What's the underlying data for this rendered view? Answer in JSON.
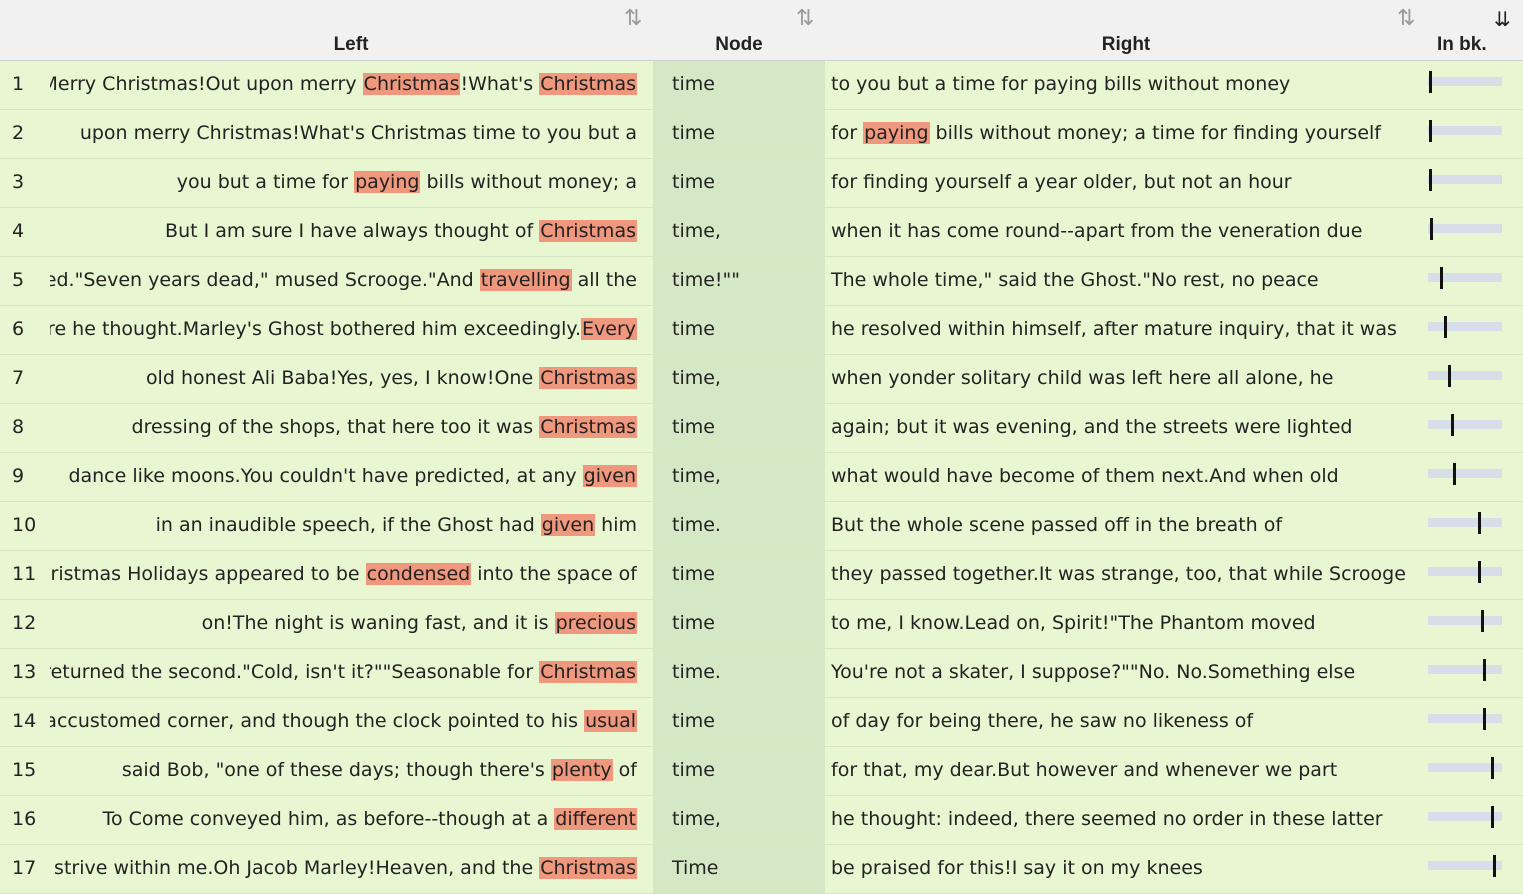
{
  "columns": {
    "left": "Left",
    "node": "Node",
    "right": "Right",
    "inbook": "In bk."
  },
  "rows": [
    {
      "num": "1",
      "lpre": "?Merry Christmas!Out upon merry ",
      "lkw": "Christmas",
      "lpost": "!What's ",
      "lkw2": "Christmas",
      "lpost2": "",
      "node": "time",
      "rpre": "to you but a time for paying bills without money",
      "rkw": "",
      "rpost": "",
      "pos": 0.02
    },
    {
      "num": "2",
      "lpre": "upon merry Christmas!What's Christmas time to you but a",
      "lkw": "",
      "lpost": "",
      "lkw2": "",
      "lpost2": "",
      "node": "time",
      "rpre": "for ",
      "rkw": "paying",
      "rpost": " bills without money; a time for finding yourself",
      "pos": 0.02
    },
    {
      "num": "3",
      "lpre": "you but a time for ",
      "lkw": "paying",
      "lpost": " bills without money; a",
      "lkw2": "",
      "lpost2": "",
      "node": "time",
      "rpre": "for finding yourself a year older, but not an hour",
      "rkw": "",
      "rpost": "",
      "pos": 0.02
    },
    {
      "num": "4",
      "lpre": "But I am sure I have always thought of ",
      "lkw": "Christmas",
      "lpost": "",
      "lkw2": "",
      "lpost2": "",
      "node": "time,",
      "rpre": "when it has come round--apart from the veneration due",
      "rkw": "",
      "rpost": "",
      "pos": 0.03
    },
    {
      "num": "5",
      "lpre": "ated.\"Seven years dead,\" mused Scrooge.\"And ",
      "lkw": "travelling",
      "lpost": " all the",
      "lkw2": "",
      "lpost2": "",
      "node": "time!\"\"",
      "rpre": "The whole time,\" said the Ghost.\"No rest, no peace",
      "rkw": "",
      "rpost": "",
      "pos": 0.17
    },
    {
      "num": "6",
      "lpre": "ore he thought.Marley's Ghost bothered him exceedingly.",
      "lkw": "Every",
      "lpost": "",
      "lkw2": "",
      "lpost2": "",
      "node": "time",
      "rpre": "he resolved within himself, after mature inquiry, that it was",
      "rkw": "",
      "rpost": "",
      "pos": 0.22
    },
    {
      "num": "7",
      "lpre": "old honest Ali Baba!Yes, yes, I know!One ",
      "lkw": "Christmas",
      "lpost": "",
      "lkw2": "",
      "lpost2": "",
      "node": "time,",
      "rpre": "when yonder solitary child was left here all alone, he",
      "rkw": "",
      "rpost": "",
      "pos": 0.28
    },
    {
      "num": "8",
      "lpre": "dressing of the shops, that here too it was ",
      "lkw": "Christmas",
      "lpost": "",
      "lkw2": "",
      "lpost2": "",
      "node": "time",
      "rpre": "again; but it was evening, and the streets were lighted",
      "rkw": "",
      "rpost": "",
      "pos": 0.32
    },
    {
      "num": "9",
      "lpre": "dance like moons.You couldn't have predicted, at any ",
      "lkw": "given",
      "lpost": "",
      "lkw2": "",
      "lpost2": "",
      "node": "time,",
      "rpre": "what would have become of them next.And when old",
      "rkw": "",
      "rpost": "",
      "pos": 0.35
    },
    {
      "num": "10",
      "lpre": "in an inaudible speech, if the Ghost had ",
      "lkw": "given",
      "lpost": " him",
      "lkw2": "",
      "lpost2": "",
      "node": "time.",
      "rpre": "But the whole scene passed off in the breath of",
      "rkw": "",
      "rpost": "",
      "pos": 0.7
    },
    {
      "num": "11",
      "lpre": "hristmas Holidays appeared to be ",
      "lkw": "condensed",
      "lpost": " into the space of",
      "lkw2": "",
      "lpost2": "",
      "node": "time",
      "rpre": "they passed together.It was strange, too, that while Scrooge",
      "rkw": "",
      "rpost": "",
      "pos": 0.71
    },
    {
      "num": "12",
      "lpre": "on!The night is waning fast, and it is ",
      "lkw": "precious",
      "lpost": "",
      "lkw2": "",
      "lpost2": "",
      "node": "time",
      "rpre": "to me, I know.Lead on, Spirit!\"The Phantom moved",
      "rkw": "",
      "rpost": "",
      "pos": 0.75
    },
    {
      "num": "13",
      "lpre": "returned the second.\"Cold, isn't it?\"\"Seasonable for ",
      "lkw": "Christmas",
      "lpost": "",
      "lkw2": "",
      "lpost2": "",
      "node": "time.",
      "rpre": "You're not a skater, I suppose?\"\"No. No.Something else",
      "rkw": "",
      "rpost": "",
      "pos": 0.77
    },
    {
      "num": "14",
      "lpre": "accustomed corner, and though the clock pointed to his ",
      "lkw": "usual",
      "lpost": "",
      "lkw2": "",
      "lpost2": "",
      "node": "time",
      "rpre": "of day for being there, he saw no likeness of",
      "rkw": "",
      "rpost": "",
      "pos": 0.78
    },
    {
      "num": "15",
      "lpre": "said Bob, \"one of these days; though there's ",
      "lkw": "plenty",
      "lpost": " of",
      "lkw2": "",
      "lpost2": "",
      "node": "time",
      "rpre": "for that, my dear.But however and whenever we part",
      "rkw": "",
      "rpost": "",
      "pos": 0.89
    },
    {
      "num": "16",
      "lpre": "To Come conveyed him, as before--though at a ",
      "lkw": "different",
      "lpost": "",
      "lkw2": "",
      "lpost2": "",
      "node": "time,",
      "rpre": "he thought: indeed, there seemed no order in these latter",
      "rkw": "",
      "rpost": "",
      "pos": 0.89
    },
    {
      "num": "17",
      "lpre": "strive within me.Oh Jacob Marley!Heaven, and the ",
      "lkw": "Christmas",
      "lpost": "",
      "lkw2": "",
      "lpost2": "",
      "node": "Time",
      "rpre": "be praised for this!I say it on my knees",
      "rkw": "",
      "rpost": "",
      "pos": 0.91
    }
  ]
}
